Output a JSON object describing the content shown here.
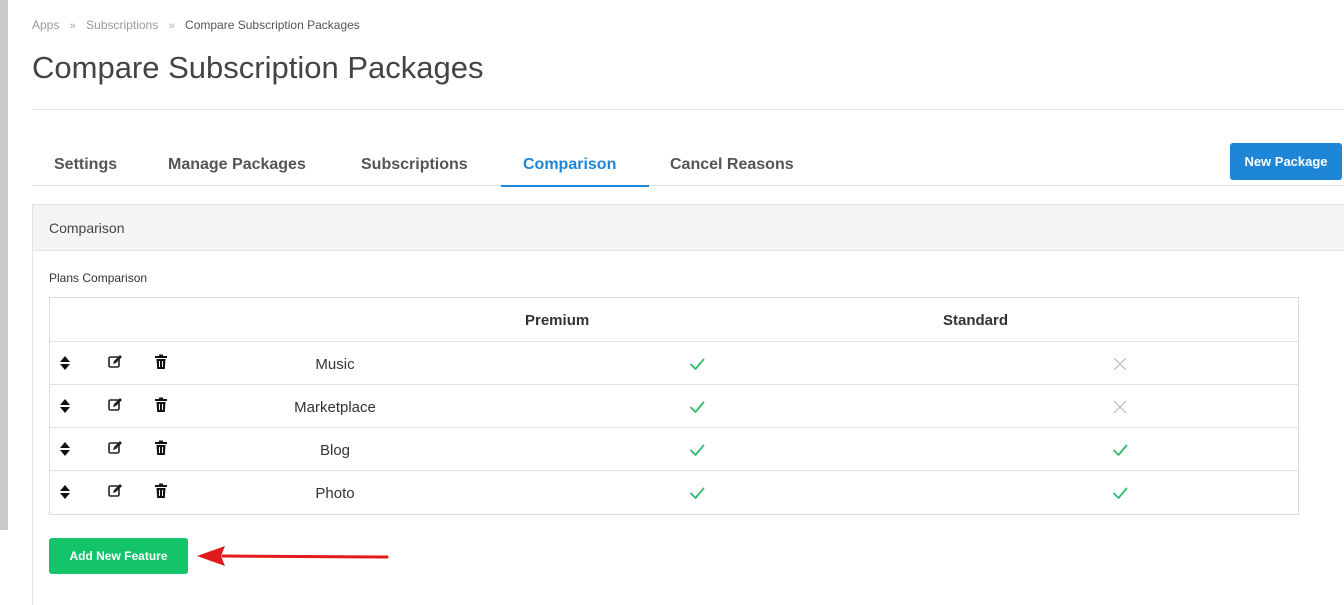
{
  "breadcrumb": {
    "items": [
      "Apps",
      "Subscriptions"
    ],
    "current": "Compare Subscription Packages",
    "separator": "»"
  },
  "page": {
    "title": "Compare Subscription Packages"
  },
  "tabs": [
    {
      "label": "Settings",
      "active": false
    },
    {
      "label": "Manage Packages",
      "active": false
    },
    {
      "label": "Subscriptions",
      "active": false
    },
    {
      "label": "Comparison",
      "active": true
    },
    {
      "label": "Cancel Reasons",
      "active": false
    }
  ],
  "toolbar": {
    "new_package_label": "New Package"
  },
  "panel": {
    "title": "Comparison",
    "section_label": "Plans Comparison",
    "table": {
      "columns": [
        "Premium",
        "Standard"
      ],
      "rows": [
        {
          "feature": "Music",
          "premium": true,
          "standard": false
        },
        {
          "feature": "Marketplace",
          "premium": true,
          "standard": false
        },
        {
          "feature": "Blog",
          "premium": true,
          "standard": true
        },
        {
          "feature": "Photo",
          "premium": true,
          "standard": true
        }
      ],
      "row_icons": [
        "sort-icon",
        "edit-icon",
        "trash-icon"
      ]
    },
    "add_feature_label": "Add New Feature"
  },
  "colors": {
    "accent": "#1e86d6",
    "success": "#13c46a",
    "check": "#2ebd6b",
    "cross": "#c4c4c4",
    "annotation_arrow": "#e11b1b"
  }
}
